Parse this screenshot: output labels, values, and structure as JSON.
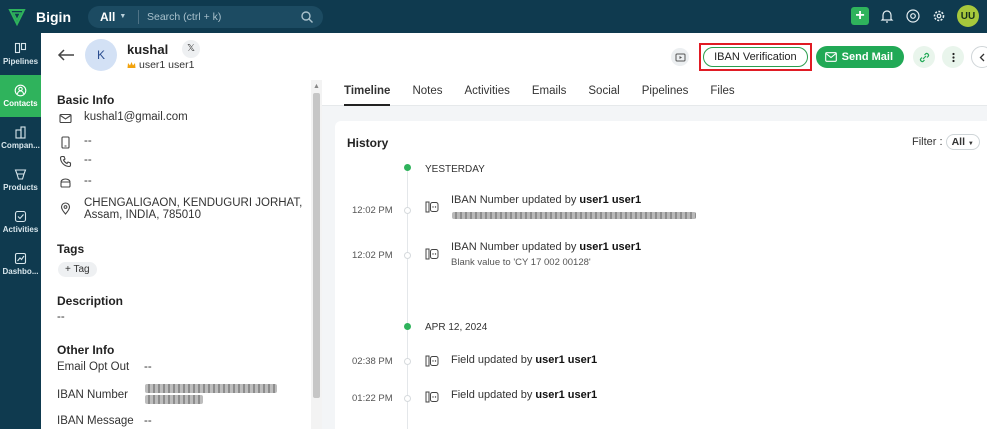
{
  "app": {
    "name": "Bigin"
  },
  "search": {
    "scope": "All",
    "placeholder": "Search (ctrl + k)"
  },
  "user": {
    "initials": "UU"
  },
  "nav": [
    {
      "label": "Pipelines",
      "icon": "pipelines-icon",
      "active": false
    },
    {
      "label": "Contacts",
      "icon": "contacts-icon",
      "active": true
    },
    {
      "label": "Compan...",
      "icon": "companies-icon",
      "active": false
    },
    {
      "label": "Products",
      "icon": "products-icon",
      "active": false
    },
    {
      "label": "Activities",
      "icon": "activities-icon",
      "active": false
    },
    {
      "label": "Dashbo...",
      "icon": "dashboards-icon",
      "active": false
    }
  ],
  "contact": {
    "initial": "K",
    "name": "kushal",
    "owner": "user1 user1"
  },
  "actions": {
    "iban": "IBAN Verification",
    "send_mail": "Send Mail"
  },
  "basic_info": {
    "title": "Basic Info",
    "email": "kushal1@gmail.com",
    "mobile": "--",
    "phone": "--",
    "fax": "--",
    "address_line1": "CHENGALIGAON, KENDUGURI JORHAT,",
    "address_line2": "Assam, INDIA, 785010"
  },
  "tags": {
    "title": "Tags",
    "add": "+ Tag"
  },
  "description": {
    "title": "Description",
    "value": "--"
  },
  "other_info": {
    "title": "Other Info",
    "email_opt_out_label": "Email Opt Out",
    "email_opt_out_value": "--",
    "iban_number_label": "IBAN Number",
    "iban_message_label": "IBAN Message",
    "iban_message_value": "--"
  },
  "tabs": [
    "Timeline",
    "Notes",
    "Activities",
    "Emails",
    "Social",
    "Pipelines",
    "Files"
  ],
  "timeline": {
    "history": "History",
    "filter_label": "Filter :",
    "filter_value": "All",
    "days": [
      "YESTERDAY",
      "APR 12, 2024"
    ],
    "events": [
      {
        "time": "12:02 PM",
        "text": "IBAN Number updated by ",
        "user": "user1 user1",
        "sub": ""
      },
      {
        "time": "12:02 PM",
        "text": "IBAN Number updated by ",
        "user": "user1 user1",
        "sub": "Blank value to 'CY 17 002 00128'"
      },
      {
        "time": "02:38 PM",
        "text": "Field updated by ",
        "user": "user1 user1",
        "sub": ""
      },
      {
        "time": "01:22 PM",
        "text": "Field updated by ",
        "user": "user1 user1",
        "sub": ""
      }
    ]
  },
  "colors": {
    "brand_dark": "#0f3a4f",
    "accent_green": "#2fb35c",
    "highlight_red": "#e01b24"
  }
}
